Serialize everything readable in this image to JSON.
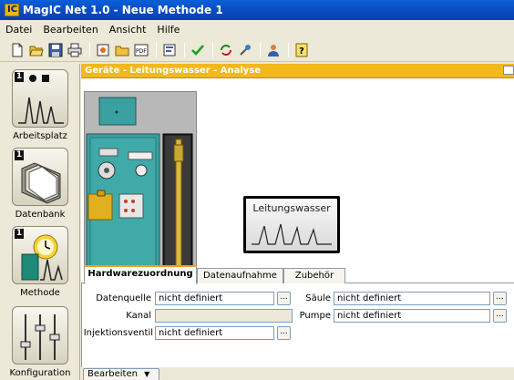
{
  "window": {
    "title": "MagIC Net 1.0 - Neue Methode 1",
    "logo_text": "IC"
  },
  "menu": {
    "items": [
      "Datei",
      "Bearbeiten",
      "Ansicht",
      "Hilfe"
    ]
  },
  "toolbar": {
    "buttons": [
      "new-icon",
      "open-icon",
      "save-icon",
      "print-icon",
      "report-icon",
      "folder-icon",
      "pdf-icon",
      "properties-icon",
      "check-icon",
      "refresh-icon",
      "tools-icon",
      "user-icon",
      "help-icon"
    ],
    "pdf_label": "PDF",
    "help_label": "?"
  },
  "nav": {
    "items": [
      {
        "label": "Arbeitsplatz",
        "badge": "1"
      },
      {
        "label": "Datenbank",
        "badge": "1"
      },
      {
        "label": "Methode",
        "badge": "1"
      },
      {
        "label": "Konfiguration",
        "badge": ""
      }
    ]
  },
  "panel": {
    "title": "Geräte - Leitungswasser - Analyse",
    "sample_label": "Leitungswasser"
  },
  "tabs": [
    "Hardwarezuordnung",
    "Datenaufnahme",
    "Zubehör"
  ],
  "hardware": {
    "datenquelle_label": "Datenquelle",
    "datenquelle_value": "nicht definiert",
    "kanal_label": "Kanal",
    "kanal_value": "",
    "injektionsventil_label": "Injektionsventil",
    "injektionsventil_value": "nicht definiert",
    "saeule_label": "Säule",
    "saeule_value": "nicht definiert",
    "pumpe_label": "Pumpe",
    "pumpe_value": "nicht definiert",
    "browse_label": "..."
  },
  "bottom": {
    "bearbeiten_label": "Bearbeiten"
  },
  "colors": {
    "titlebar": "#0a4fc4",
    "panel_header": "#f2b81c",
    "instrument_teal": "#3aa0a0"
  }
}
